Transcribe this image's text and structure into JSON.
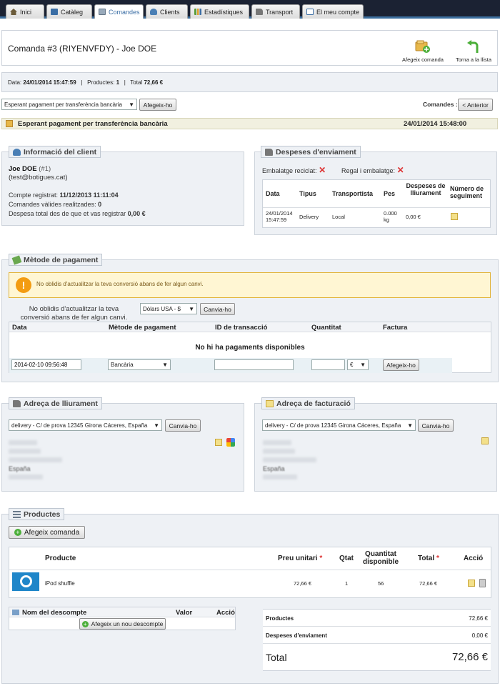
{
  "nav": {
    "tabs": [
      {
        "label": "Inici",
        "icon": "home-icon"
      },
      {
        "label": "Catàleg",
        "icon": "catalog-icon"
      },
      {
        "label": "Comandes",
        "icon": "orders-icon"
      },
      {
        "label": "Clients",
        "icon": "customers-icon"
      },
      {
        "label": "Estadístiques",
        "icon": "stats-icon"
      },
      {
        "label": "Transport",
        "icon": "truck-icon"
      },
      {
        "label": "El meu compte",
        "icon": "account-icon"
      }
    ],
    "active": "Comandes"
  },
  "header": {
    "title": "Comanda #3 (RIYENVFDY) - Joe DOE",
    "add_order": "Afegeix comanda",
    "back_to_list": "Torna a la llista"
  },
  "infobar": {
    "date_label": "Data:",
    "date_value": "24/01/2014 15:47:59",
    "sep1": "|",
    "products_label": "Productes:",
    "products_value": "1",
    "sep2": "|",
    "total_label": "Total",
    "total_value": "72,66 €"
  },
  "status_select": {
    "value": "Esperant pagament per transferència bancària",
    "button": "Afegeix-ho"
  },
  "orders_nav": {
    "label": "Comandes :",
    "previous": "< Anterior"
  },
  "current_status": {
    "label": "Esperant pagament per transferència bancària",
    "date": "24/01/2014 15:48:00"
  },
  "client": {
    "legend": "Informació del client",
    "name": "Joe DOE",
    "id": "(#1)",
    "email": "(test@botigues.cat)",
    "registered_label": "Compte registrat:",
    "registered_value": "11/12/2013 11:11:04",
    "valid_orders_label": "Comandes vàlides realitzades:",
    "valid_orders_value": "0",
    "total_spent_label": "Despesa total des de que et vas registrar",
    "total_spent_value": "0,00 €"
  },
  "shipping": {
    "legend": "Despeses d'enviament",
    "recycled": "Embalatge reciclat:",
    "gift": "Regal i embalatge:",
    "headers": [
      "Data",
      "Tipus",
      "Transportista",
      "Pes",
      "Despeses de lliurament",
      "Número de seguiment"
    ],
    "row": {
      "date_line1": "24/01/2014",
      "date_line2": "15:47:59",
      "type": "Delivery",
      "carrier": "Local",
      "weight_line1": "0.000",
      "weight_line2": "kg",
      "cost": "0,00 €"
    }
  },
  "payment": {
    "legend": "Mètode de pagament",
    "warning": "No oblidis d'actualitzar la teva conversió abans de fer algun canvi.",
    "convert_line1": "No oblidis d'actualitzar la teva",
    "convert_line2": "conversió abans de fer algun canvi.",
    "currency": "Dòlars USA - $",
    "change": "Canvia-ho",
    "headers": [
      "Data",
      "Mètode de pagament",
      "ID de transacció",
      "Quantitat",
      "Factura"
    ],
    "empty": "No hi ha pagaments disponibles",
    "date_value": "2014-02-10 09:56:48",
    "method": "Bancària",
    "currency_symbol": "€",
    "add": "Afegeix-ho"
  },
  "delivery_address": {
    "legend": "Adreça de lliurament",
    "select": "delivery - C/ de prova 12345 Girona Cáceres, España",
    "change": "Canvia-ho",
    "country": "España"
  },
  "invoice_address": {
    "legend": "Adreça de facturació",
    "select": "delivery - C/ de prova 12345 Girona Cáceres, España",
    "change": "Canvia-ho",
    "country": "España"
  },
  "products": {
    "legend": "Productes",
    "add_order": "Afegeix comanda",
    "headers": {
      "product": "Producte",
      "unit_price": "Preu unitari",
      "qty": "Qtat",
      "available_line1": "Quantitat",
      "available_line2": "disponible",
      "total": "Total",
      "action": "Acció"
    },
    "required_mark": "*",
    "row": {
      "name": "iPod shuffle",
      "unit_price": "72,66 €",
      "qty": "1",
      "available": "56",
      "total": "72,66 €"
    }
  },
  "discounts": {
    "headers": {
      "name": "Nom del descompte",
      "value": "Valor",
      "action": "Acció"
    },
    "add": "Afegeix un nou descompte"
  },
  "summary": {
    "products_label": "Productes",
    "products_value": "72,66 €",
    "shipping_label": "Despeses d'enviament",
    "shipping_value": "0,00 €",
    "total_label": "Total",
    "total_value": "72,66 €"
  },
  "colors": {
    "accent": "#3b6ea5",
    "warning": "#f39c12",
    "error": "#d33"
  }
}
